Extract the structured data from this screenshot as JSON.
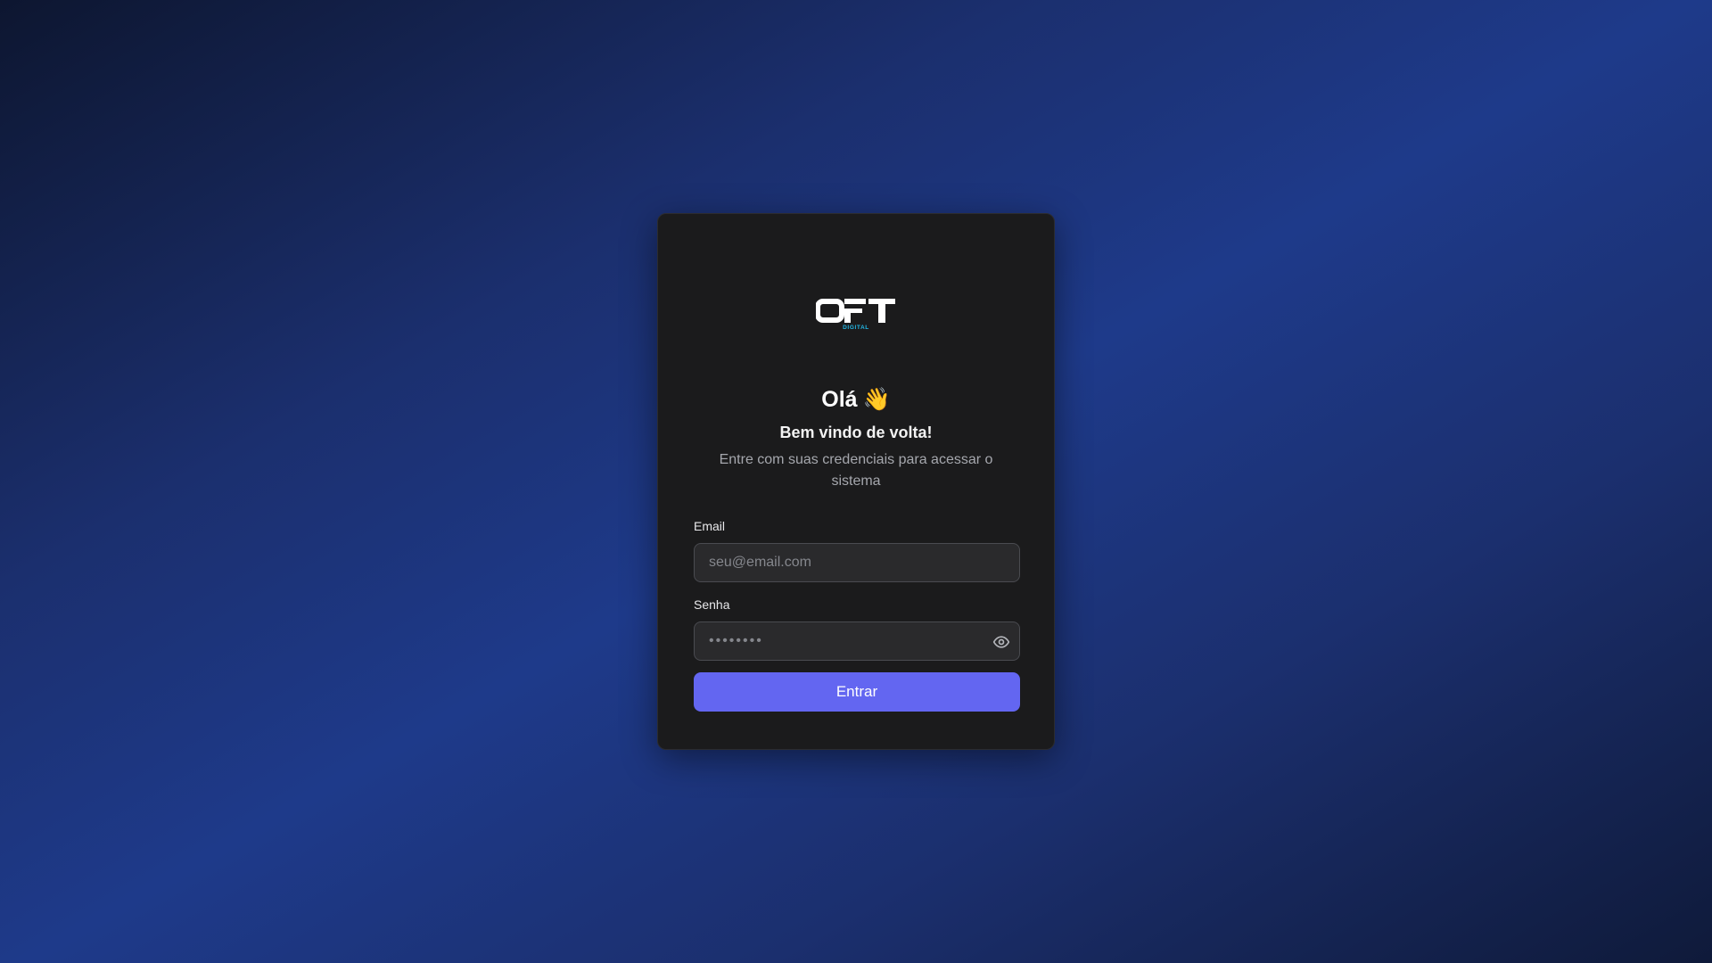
{
  "brand": {
    "logo_text": "OFT",
    "logo_subtext": "DIGITAL",
    "logo_accent": "#22b8e6"
  },
  "header": {
    "greeting": "Olá",
    "greeting_icon": "waving-hand-icon",
    "greeting_emoji": "👋",
    "welcome": "Bem vindo de volta!",
    "subtitle": "Entre com suas credenciais para acessar o sistema"
  },
  "form": {
    "email": {
      "label": "Email",
      "placeholder": "seu@email.com",
      "value": ""
    },
    "password": {
      "label": "Senha",
      "placeholder": "••••••••",
      "value": "",
      "toggle_icon": "eye-icon"
    },
    "submit_label": "Entrar"
  },
  "colors": {
    "card_background": "#1b1b1c",
    "primary_button": "#6366f1",
    "background_gradient": [
      "#0d1630",
      "#1e3a8a",
      "#0f1a3a"
    ]
  }
}
